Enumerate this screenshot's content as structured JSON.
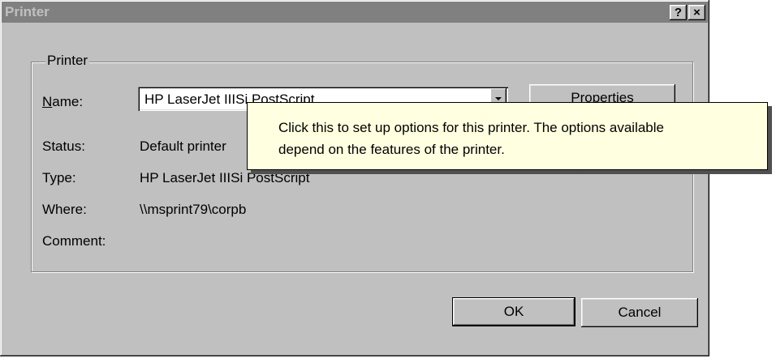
{
  "window": {
    "title": "Printer",
    "help_button": "?",
    "close_button": "×"
  },
  "printer_group": {
    "label": "Printer",
    "name_label_underlined": "N",
    "name_label_rest": "ame:",
    "name_value": "HP LaserJet IIISi PostScript",
    "status_label": "Status:",
    "status_value": "Default printer",
    "type_label": "Type:",
    "type_value": "HP LaserJet IIISi PostScript",
    "where_label": "Where:",
    "where_value": "\\\\msprint79\\corpb",
    "comment_label": "Comment:",
    "comment_value": ""
  },
  "buttons": {
    "properties": "Properties",
    "ok": "OK",
    "cancel": "Cancel"
  },
  "tooltip": {
    "line1": "Click this to set up options for this printer. The options available",
    "line2": "depend on the features of the printer."
  },
  "colors": {
    "dialog_face": "#c0c0c0",
    "titlebar_inactive": "#808080",
    "tooltip_bg": "#ffffcc"
  }
}
